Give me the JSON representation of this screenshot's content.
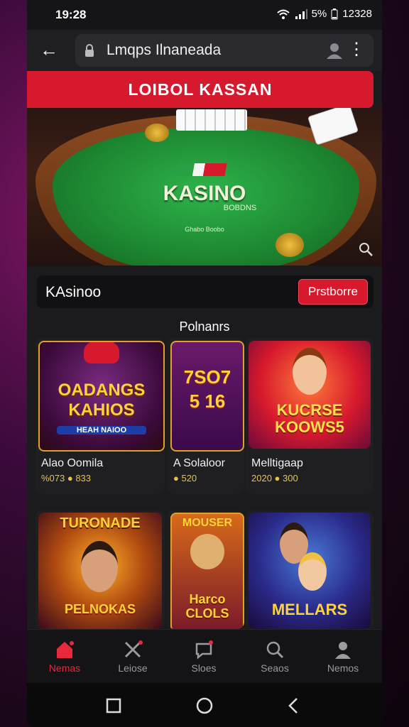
{
  "status": {
    "time": "19:28",
    "battery": "5%",
    "right_value": "12328"
  },
  "urlbar": {
    "address": "Lmqps Ilnaneada"
  },
  "banner": {
    "text": "LOIBOL KASSAN"
  },
  "hero": {
    "title": "KASINO",
    "subtitle": "BOBDNS",
    "small": "Ghabo Boobo"
  },
  "section": {
    "title": "KAsinoo",
    "button": "Prstborre"
  },
  "popular": {
    "label": "Polnanrs"
  },
  "games": [
    {
      "thumb_title": "OADANGS KAHIOS",
      "thumb_sub": "HEAH NAIOO",
      "name": "Alao Oomila",
      "price": "%073 ● 833"
    },
    {
      "thumb_title": "7SO7 5 16",
      "thumb_sub": "",
      "name": "A Solaloor",
      "price": "● 520"
    },
    {
      "thumb_title": "KUCRSE KOOWS5",
      "thumb_sub": "",
      "name": "Melltigaap",
      "price": "2020 ● 300"
    },
    {
      "thumb_title": "TURONADE",
      "thumb_sub": "PELNOKAS",
      "name": "",
      "price": ""
    },
    {
      "thumb_title": "MOUSER",
      "thumb_sub": "Harco CLOLS",
      "name": "",
      "price": ""
    },
    {
      "thumb_title": "MELLARS",
      "thumb_sub": "",
      "name": "",
      "price": ""
    }
  ],
  "nav": [
    {
      "label": "Nemas",
      "icon": "home-icon"
    },
    {
      "label": "Leiose",
      "icon": "tools-icon"
    },
    {
      "label": "Sloes",
      "icon": "chat-icon"
    },
    {
      "label": "Seaos",
      "icon": "search-icon"
    },
    {
      "label": "Nemos",
      "icon": "person-icon"
    }
  ],
  "colors": {
    "accent": "#d7192d",
    "felt": "#1e8a33",
    "background": "#1b1b1d"
  }
}
